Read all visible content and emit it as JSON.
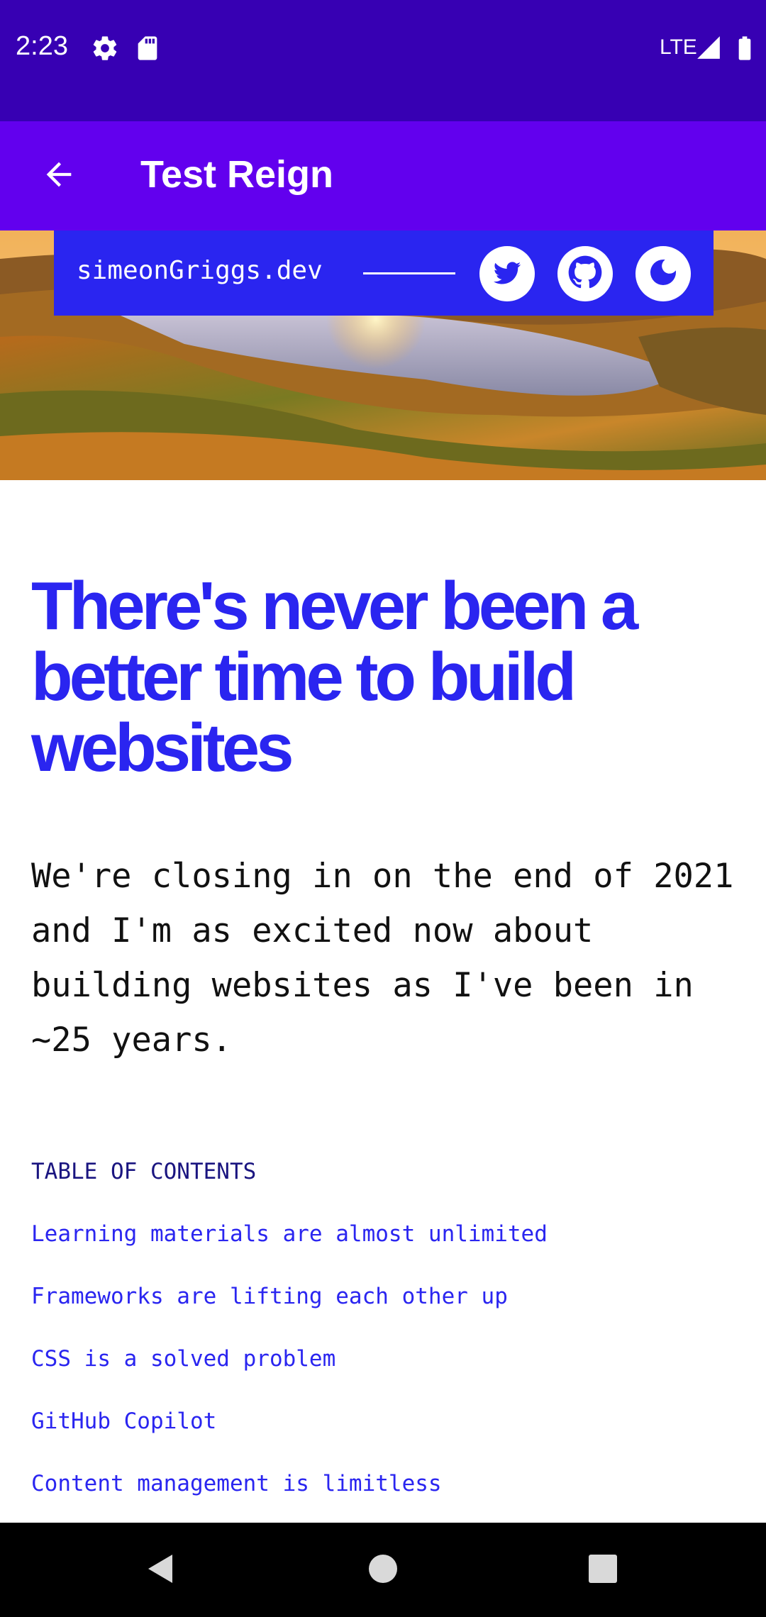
{
  "status_bar": {
    "time": "2:23",
    "network": "LTE",
    "icons": [
      "settings-icon",
      "sd-card-icon",
      "signal-icon",
      "battery-icon"
    ]
  },
  "app_bar": {
    "title": "Test Reign",
    "back_icon": "arrow-back-icon"
  },
  "site_header": {
    "name": "simeonGriggs.dev",
    "social": [
      "twitter-icon",
      "github-icon",
      "moon-icon"
    ]
  },
  "article": {
    "title": "There's never been a better time to build websites",
    "intro": "We're closing in on the end of 2021 and I'm as excited now about building websites as I've been in ~25 years."
  },
  "toc": {
    "heading": "TABLE OF CONTENTS",
    "items": [
      "Learning materials are almost unlimited",
      "Frameworks are lifting each other up",
      "CSS is a solved problem",
      "GitHub Copilot",
      "Content management is limitless"
    ]
  },
  "colors": {
    "status_bar": "#3700b3",
    "app_bar": "#6200ee",
    "brand_blue": "#2a25f0",
    "toc_heading": "#1a1580"
  }
}
